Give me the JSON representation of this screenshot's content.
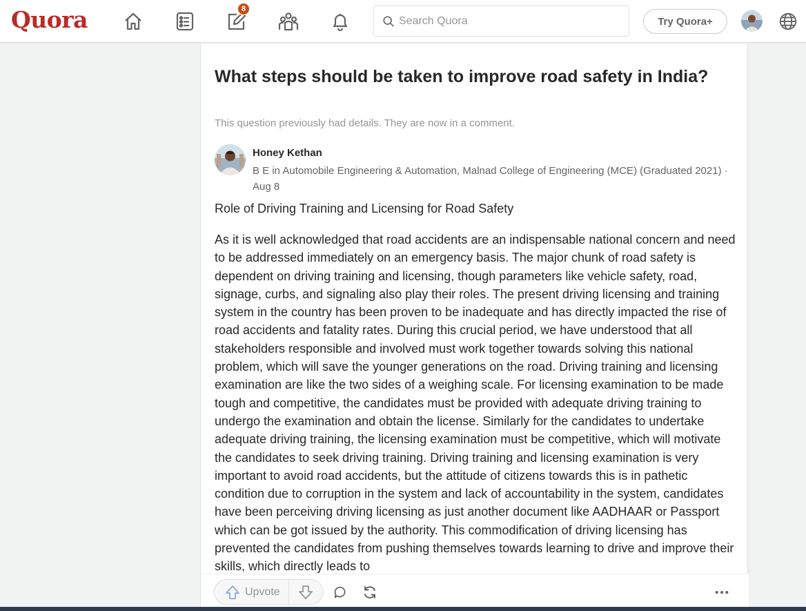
{
  "header": {
    "logo": "Quora",
    "notification_count": "8",
    "search_placeholder": "Search Quora",
    "try_button": "Try Quora+"
  },
  "question": {
    "title": "What steps should be taken to improve road safety in India?",
    "subtitle": "This question previously had details. They are now in a comment."
  },
  "answer": {
    "author_name": "Honey Kethan",
    "credential": "B E in Automobile Engineering & Automation, Malnad College of Engineering (MCE) (Graduated 2021) · Aug 8",
    "heading": "Role of Driving Training and Licensing for Road Safety",
    "body": "As it is well acknowledged that road accidents are an indispensable national concern and need to be addressed immediately on an emergency basis. The major chunk of road safety is dependent on driving training and licensing, though parameters like vehicle safety, road, signage, curbs, and signaling also play their roles. The present driving licensing and training system in the country has been proven to be inadequate and has directly impacted the rise of road accidents and fatality rates. During this crucial period, we have understood that all stakeholders responsible and involved must work together towards solving this national problem, which will save the younger generations on the road. Driving training and licensing examination are like the two sides of a weighing scale. For licensing examination to be made tough and competitive, the candidates must be provided with adequate driving training to undergo the examination and obtain the license. Similarly for the candidates to undertake adequate driving training, the licensing examination must be competitive, which will motivate the candidates to seek driving training. Driving training and licensing examination is very important to avoid road accidents, but the attitude of citizens towards this is in pathetic condition due to corruption in the system and lack of accountability in the system, candidates have been perceiving driving licensing as just another document like AADHAAR or Passport which can be got issued by the authority. This commodification of driving licensing has prevented the candidates from pushing themselves towards learning to drive and improve their skills, which directly leads to"
  },
  "actions": {
    "upvote_label": "Upvote"
  },
  "colors": {
    "brand": "#b92b27",
    "badge": "#cb4b10",
    "upvote_icon": "#86a8e7"
  }
}
